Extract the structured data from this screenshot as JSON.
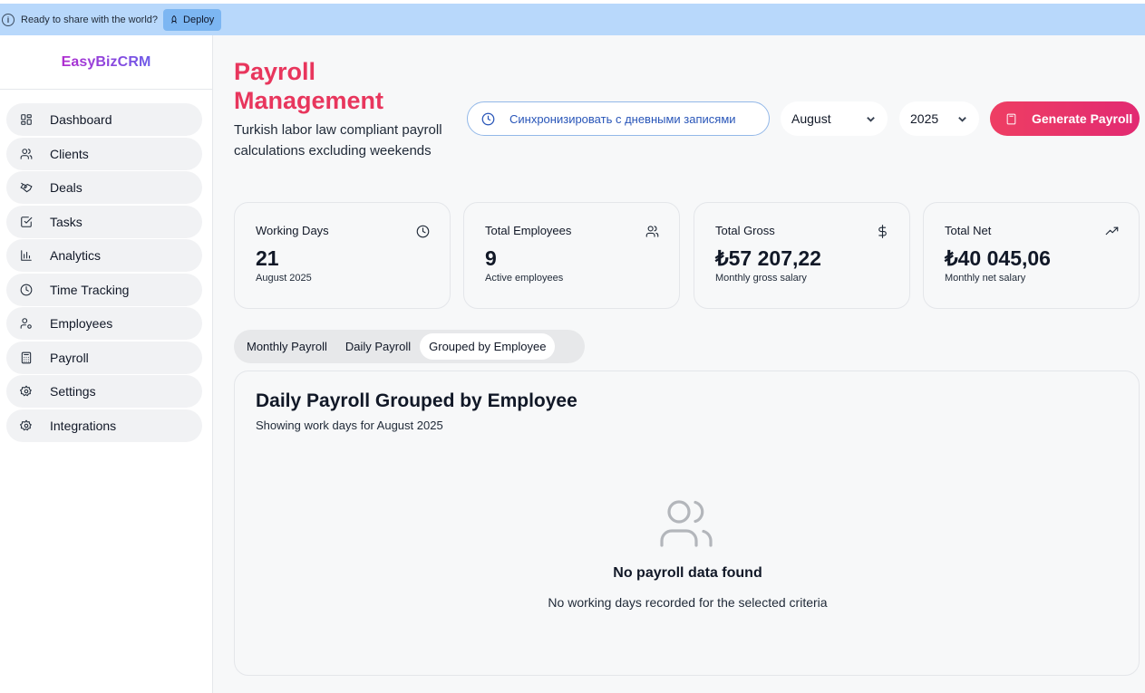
{
  "banner": {
    "text": "Ready to share with the world?",
    "deploy_label": "Deploy",
    "bg_color": "#b8d8fb"
  },
  "sidebar": {
    "brand": "EasyBizCRM",
    "items": [
      {
        "label": "Dashboard",
        "icon": "grid-icon"
      },
      {
        "label": "Clients",
        "icon": "users-icon"
      },
      {
        "label": "Deals",
        "icon": "handshake-icon"
      },
      {
        "label": "Tasks",
        "icon": "check-square-icon"
      },
      {
        "label": "Analytics",
        "icon": "bar-chart-icon"
      },
      {
        "label": "Time Tracking",
        "icon": "clock-icon"
      },
      {
        "label": "Employees",
        "icon": "user-cog-icon"
      },
      {
        "label": "Payroll",
        "icon": "calculator-icon"
      },
      {
        "label": "Settings",
        "icon": "gear-icon"
      },
      {
        "label": "Integrations",
        "icon": "gear-icon"
      }
    ]
  },
  "header": {
    "title": "Payroll Management",
    "subtitle": "Turkish labor law compliant payroll calculations excluding weekends",
    "sync_label": "Синхронизировать с дневными записями",
    "month": "August",
    "year": "2025",
    "generate_label": "Generate Payroll",
    "accent_color": "#e8365d"
  },
  "stats": [
    {
      "label": "Working Days",
      "value": "21",
      "sub": "August 2025",
      "icon": "clock-icon"
    },
    {
      "label": "Total Employees",
      "value": "9",
      "sub": "Active employees",
      "icon": "users-icon"
    },
    {
      "label": "Total Gross",
      "value": "₺57 207,22",
      "sub": "Monthly gross salary",
      "icon": "dollar-icon"
    },
    {
      "label": "Total Net",
      "value": "₺40 045,06",
      "sub": "Monthly net salary",
      "icon": "trending-up-icon"
    }
  ],
  "tabs": [
    {
      "label": "Monthly Payroll",
      "active": false
    },
    {
      "label": "Daily Payroll",
      "active": false
    },
    {
      "label": "Grouped by Employee",
      "active": true
    }
  ],
  "panel": {
    "title": "Daily Payroll Grouped by Employee",
    "subtitle": "Showing work days for August 2025",
    "empty_title": "No payroll data found",
    "empty_sub": "No working days recorded for the selected criteria"
  }
}
